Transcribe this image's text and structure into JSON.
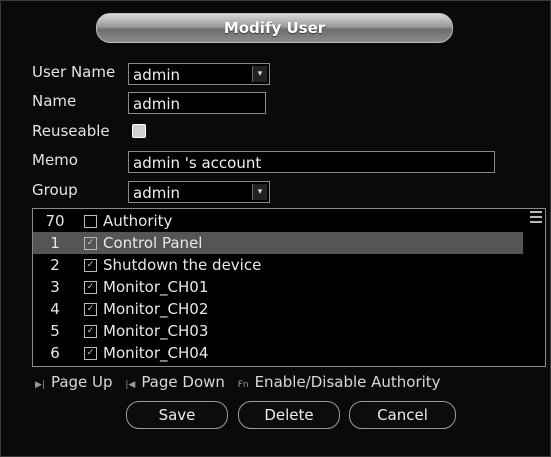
{
  "dialog": {
    "title": "Modify User"
  },
  "form": {
    "user_name": {
      "label": "User Name",
      "value": "admin"
    },
    "name": {
      "label": "Name",
      "value": "admin"
    },
    "reuseable": {
      "label": "Reuseable",
      "checked": false
    },
    "memo": {
      "label": "Memo",
      "value": "admin 's account"
    },
    "group": {
      "label": "Group",
      "value": "admin"
    }
  },
  "authority_list": {
    "header": {
      "num": "70",
      "label": "Authority"
    },
    "rows": [
      {
        "num": "1",
        "label": "Control Panel",
        "checked": true,
        "selected": true
      },
      {
        "num": "2",
        "label": "Shutdown the device",
        "checked": true
      },
      {
        "num": "3",
        "label": "Monitor_CH01",
        "checked": true
      },
      {
        "num": "4",
        "label": "Monitor_CH02",
        "checked": true
      },
      {
        "num": "5",
        "label": "Monitor_CH03",
        "checked": true
      },
      {
        "num": "6",
        "label": "Monitor_CH04",
        "checked": true
      }
    ]
  },
  "hints": {
    "page_up": "Page Up",
    "page_down": "Page Down",
    "enable_disable": "Enable/Disable Authority",
    "page_up_icon": "▶|",
    "page_down_icon": "|◀",
    "fn_icon": "Fn"
  },
  "buttons": {
    "save": "Save",
    "delete": "Delete",
    "cancel": "Cancel"
  },
  "icons": {
    "dropdown": "▾",
    "check": "✓"
  }
}
